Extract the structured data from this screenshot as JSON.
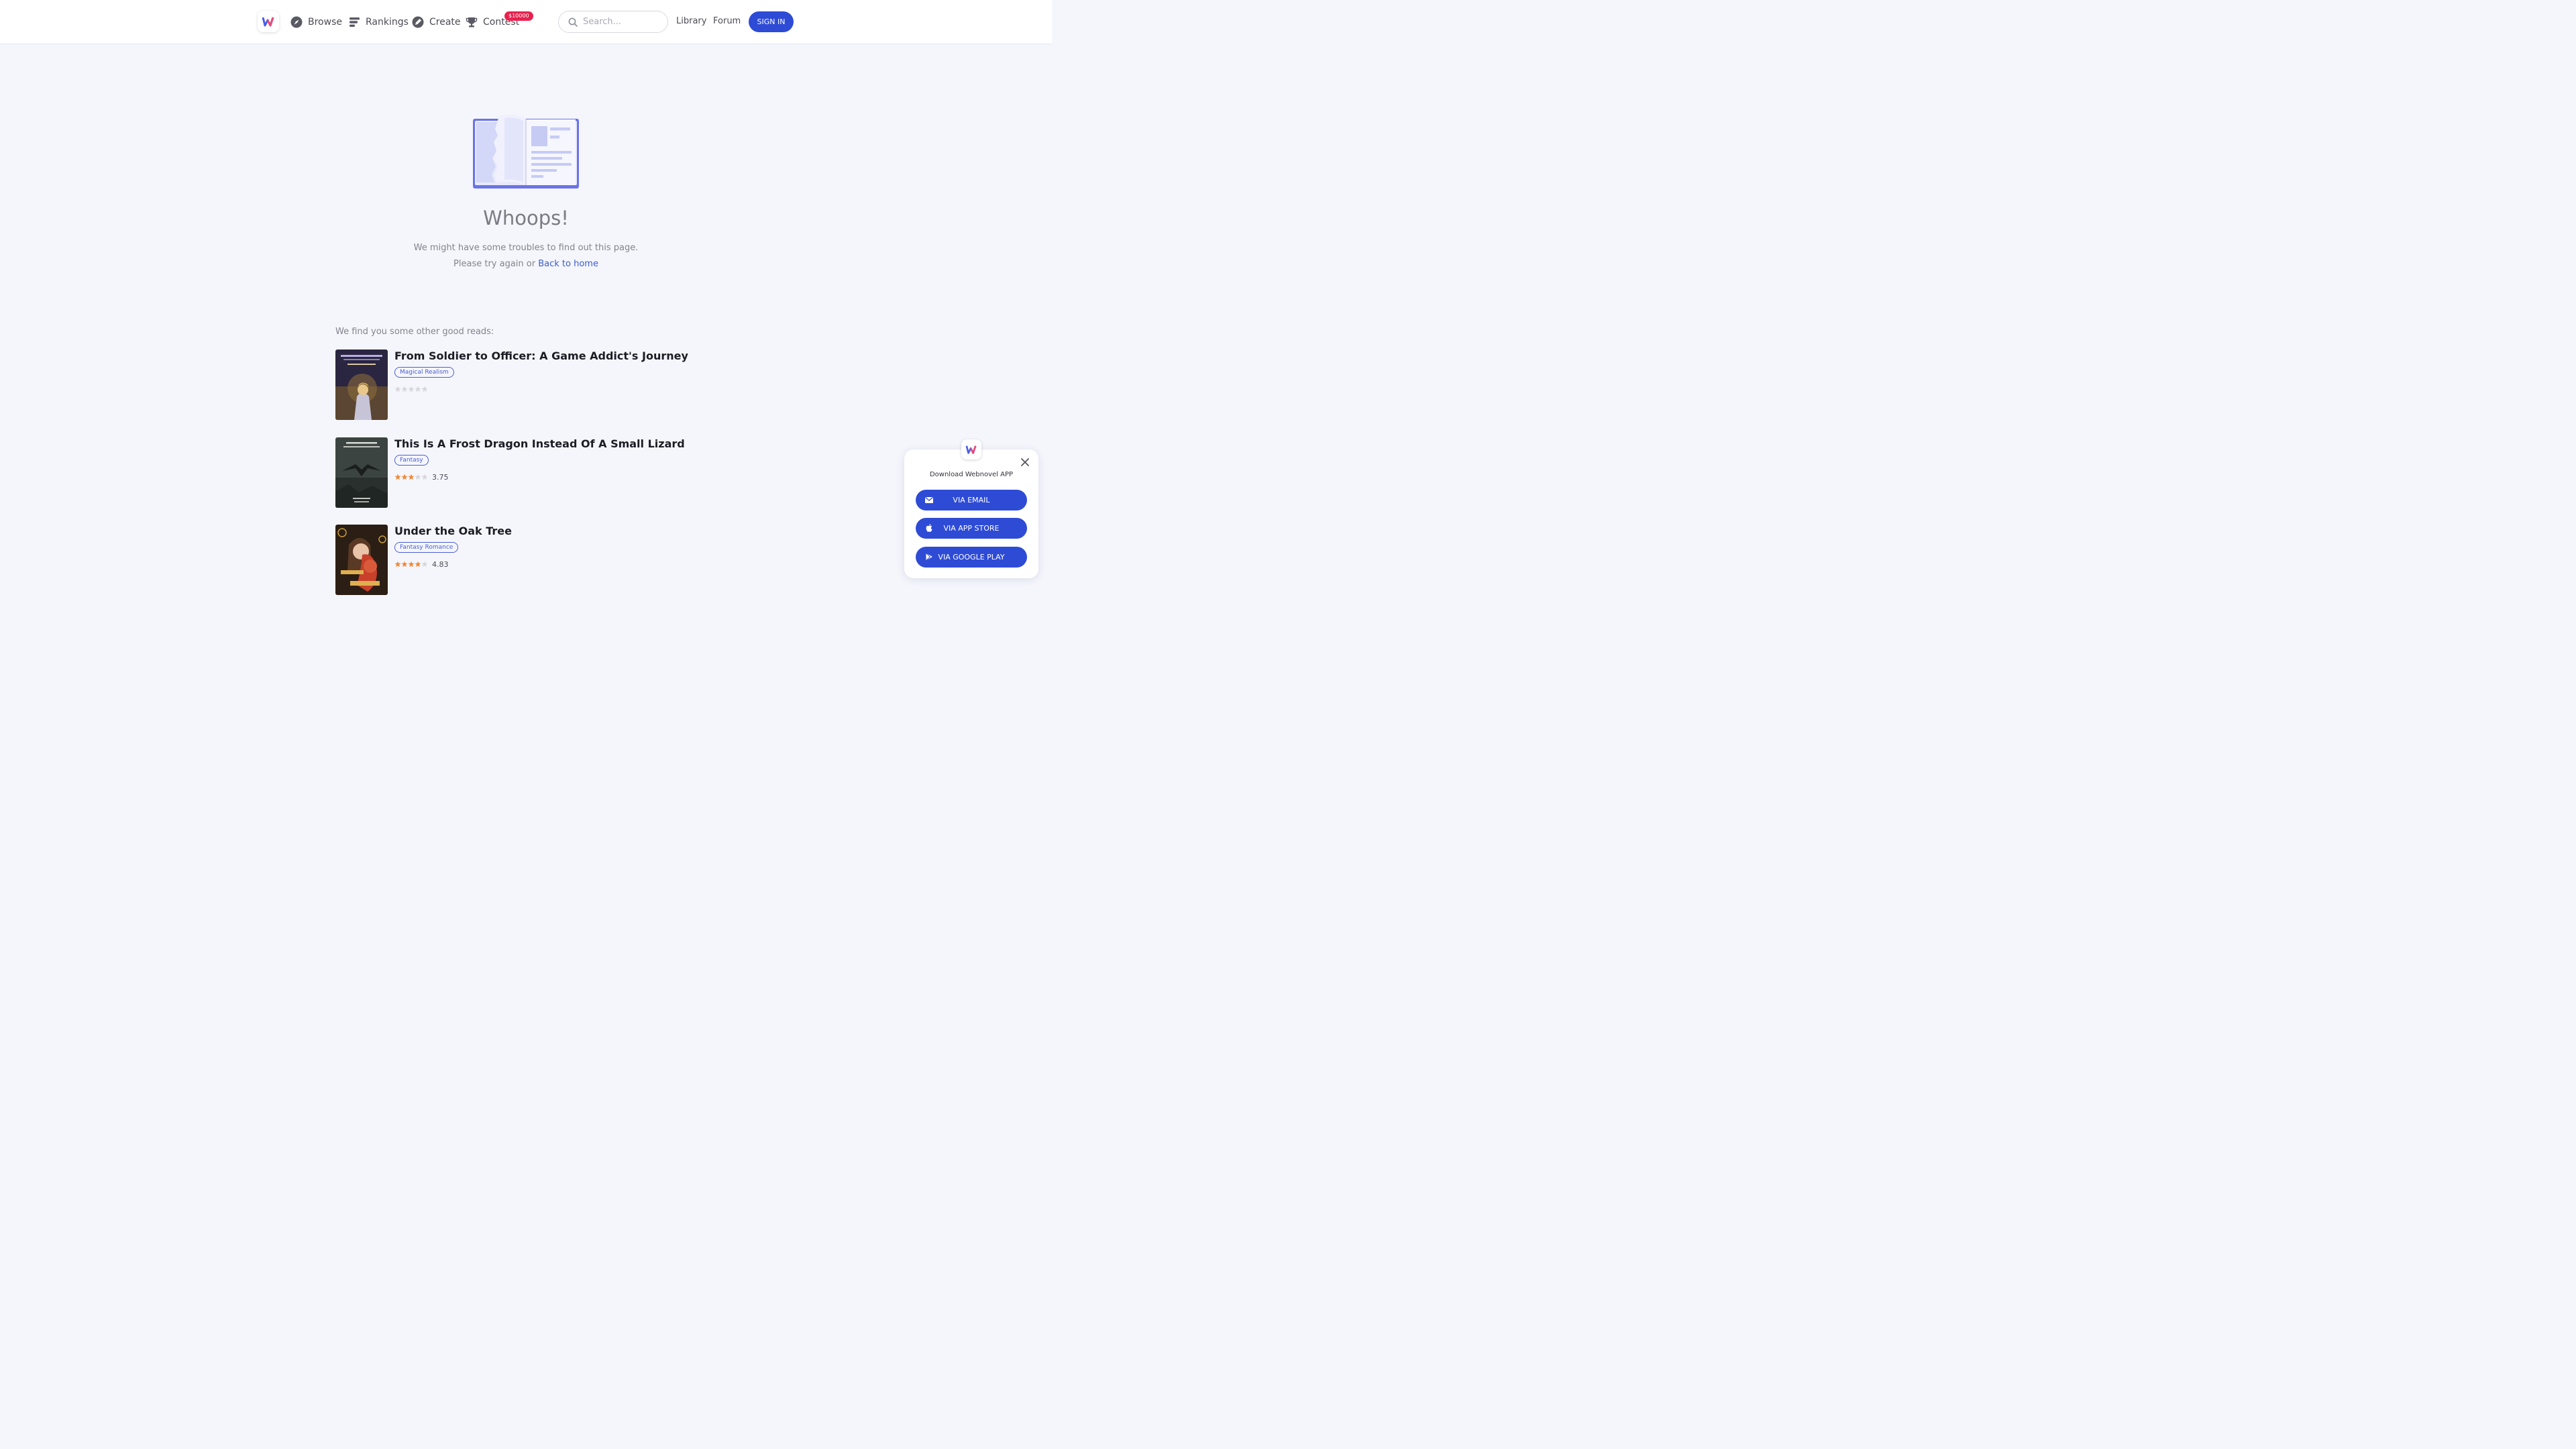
{
  "header": {
    "nav": [
      {
        "icon": "compass-icon",
        "label": "Browse"
      },
      {
        "icon": "rankings-icon",
        "label": "Rankings"
      },
      {
        "icon": "pen-icon",
        "label": "Create"
      },
      {
        "icon": "trophy-icon",
        "label": "Contest"
      }
    ],
    "contest_badge": "$10000",
    "search_placeholder": "Search...",
    "library_label": "Library",
    "forum_label": "Forum",
    "signin_label": "SIGN IN"
  },
  "error": {
    "title": "Whoops!",
    "line1": "We might have some troubles to find out this page.",
    "line2_prefix": "Please try again or",
    "back_home": "Back to home"
  },
  "recommendations": {
    "heading": "We find you some other good reads:",
    "books": [
      {
        "title": "From Soldier to Officer: A Game Addict's Journey",
        "tag": "Magical Realism",
        "stars": 0,
        "rating": ""
      },
      {
        "title": "This Is A Frost Dragon Instead Of A Small Lizard",
        "tag": "Fantasy",
        "stars": 3,
        "rating": "3.75"
      },
      {
        "title": "Under the Oak Tree",
        "tag": "Fantasy Romance",
        "stars": 4,
        "rating": "4.83"
      }
    ]
  },
  "app_popup": {
    "title": "Download Webnovel APP",
    "buttons": [
      {
        "icon": "email-icon",
        "label": "VIA EMAIL"
      },
      {
        "icon": "apple-icon",
        "label": "VIA APP STORE"
      },
      {
        "icon": "google-play-icon",
        "label": "VIA GOOGLE PLAY"
      }
    ]
  },
  "colors": {
    "accent": "#2e4bd6",
    "link": "#3a5bd6",
    "badge": "#e8224f",
    "star_filled": "#f08a3a",
    "star_empty": "#d6d6dc"
  }
}
